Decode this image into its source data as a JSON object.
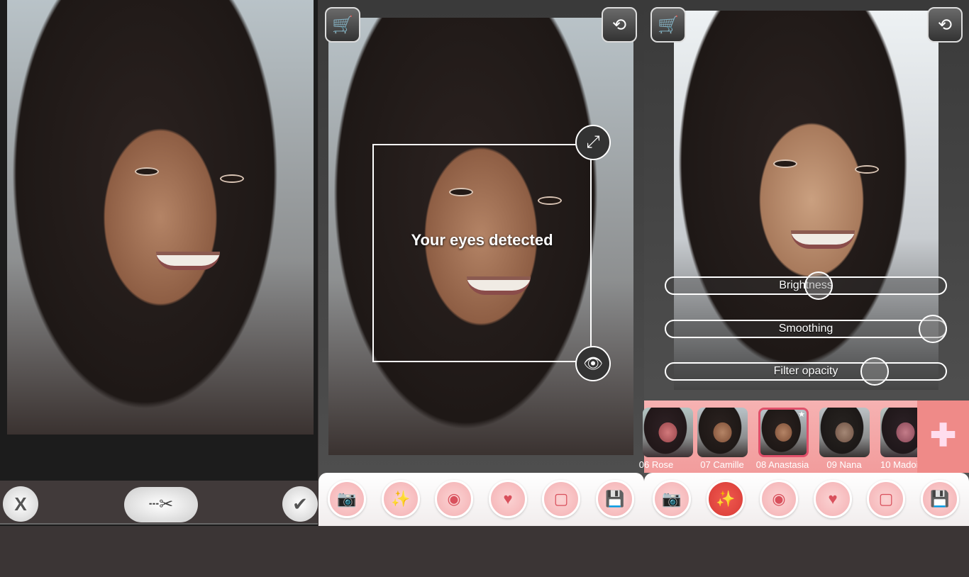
{
  "panel1": {
    "buttons": {
      "cancel": "X",
      "crop_icon": "scissors-icon",
      "confirm_icon": "checkmark-icon"
    }
  },
  "panel2": {
    "cart_icon": "cart-icon",
    "rotate_icon": "rotate-icon",
    "detection_text": "Your eyes detected",
    "resize_icon": "resize-arrows-icon",
    "eye_handle_icon": "eye-icon"
  },
  "panel3": {
    "sliders": [
      {
        "label": "Brightness",
        "value": 0.54
      },
      {
        "label": "Smoothing",
        "value": 0.96
      },
      {
        "label": "Filter opacity",
        "value": 0.75
      }
    ],
    "filters": [
      {
        "label": "06 Rose"
      },
      {
        "label": "07 Camille"
      },
      {
        "label": "08 Anastasia",
        "selected": true
      },
      {
        "label": "09 Nana"
      },
      {
        "label": "10 Madoi"
      }
    ],
    "add_icon": "plus-icon"
  },
  "toolbar": {
    "items": [
      "camera-icon",
      "magic-wand-icon",
      "eye-icon",
      "heart-icon",
      "frame-icon",
      "save-icon"
    ],
    "active_index_panel3": 1
  },
  "colors": {
    "accent": "#f4a0a0",
    "active": "#e04440",
    "icon": "#d9505c"
  }
}
